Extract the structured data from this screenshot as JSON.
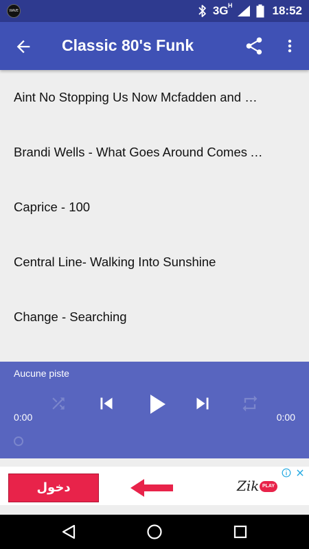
{
  "status_bar": {
    "app_badge": "WAVE FM",
    "icons": [
      "bluetooth-icon",
      "signal-icon",
      "battery-icon"
    ],
    "network": "3G",
    "network_sub": "H",
    "time": "18:52"
  },
  "app_bar": {
    "title": "Classic 80's Funk",
    "icons": [
      "back-arrow-icon",
      "share-icon",
      "more-vert-icon"
    ]
  },
  "playlist": [
    "Aint No Stopping Us Now Mcfadden and Whitehead",
    "Brandi Wells - What Goes Around Comes Around",
    "Caprice - 100",
    "Central Line- Walking Into Sunshine",
    "Change - Searching"
  ],
  "player": {
    "track": "Aucune piste",
    "elapsed": "0:00",
    "duration": "0:00",
    "icons": [
      "shuffle-icon",
      "skip-previous-icon",
      "play-icon",
      "skip-next-icon",
      "repeat-icon"
    ]
  },
  "ad": {
    "cta_label": "دخول",
    "logo_text": "Zik",
    "logo_badge": "PLAY",
    "icons": [
      "arrow-left-icon",
      "info-icon",
      "close-icon"
    ]
  },
  "colors": {
    "status_bar": "#2e3a8f",
    "app_bar": "#3f51b5",
    "player": "#5865bf",
    "ad_button": "#e8234a"
  }
}
